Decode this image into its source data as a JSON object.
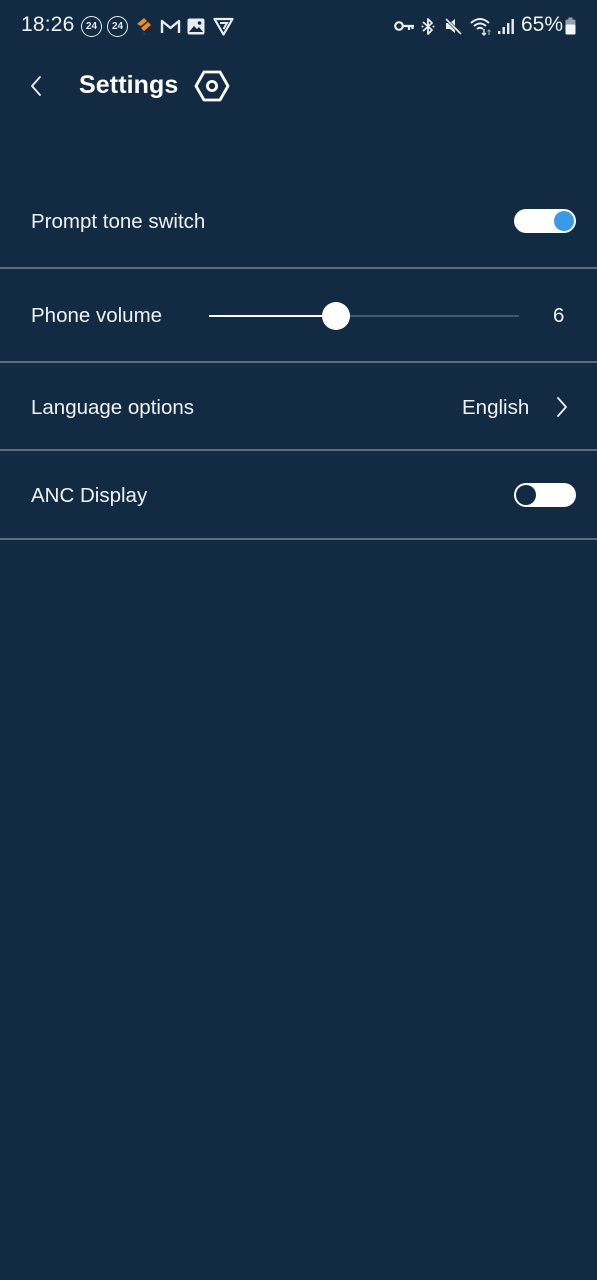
{
  "status_bar": {
    "time": "18:26",
    "notification_icons": [
      "24-badge-icon",
      "24-badge-icon",
      "orange-app-icon",
      "gmail-icon",
      "gallery-icon",
      "vpn-shield-icon"
    ],
    "badge_text": "24",
    "system_icons": [
      "vpn-key-icon",
      "bluetooth-icon",
      "mute-icon",
      "wifi-icon",
      "signal-icon",
      "battery-icon"
    ],
    "battery_percent": "65%",
    "accent_color": "#f08a24"
  },
  "header": {
    "title": "Settings",
    "back_icon": "chevron-left-icon",
    "settings_icon": "hexagon-gear-icon"
  },
  "settings": {
    "prompt_tone": {
      "label": "Prompt tone switch",
      "enabled": true
    },
    "phone_volume": {
      "label": "Phone volume",
      "value": "6",
      "slider_fraction": 0.41
    },
    "language": {
      "label": "Language options",
      "value": "English"
    },
    "anc_display": {
      "label": "ANC Display",
      "enabled": false
    }
  },
  "colors": {
    "background": "#132b42",
    "toggle_on_knob": "#3a9ae8",
    "divider": "#5b6e80"
  }
}
